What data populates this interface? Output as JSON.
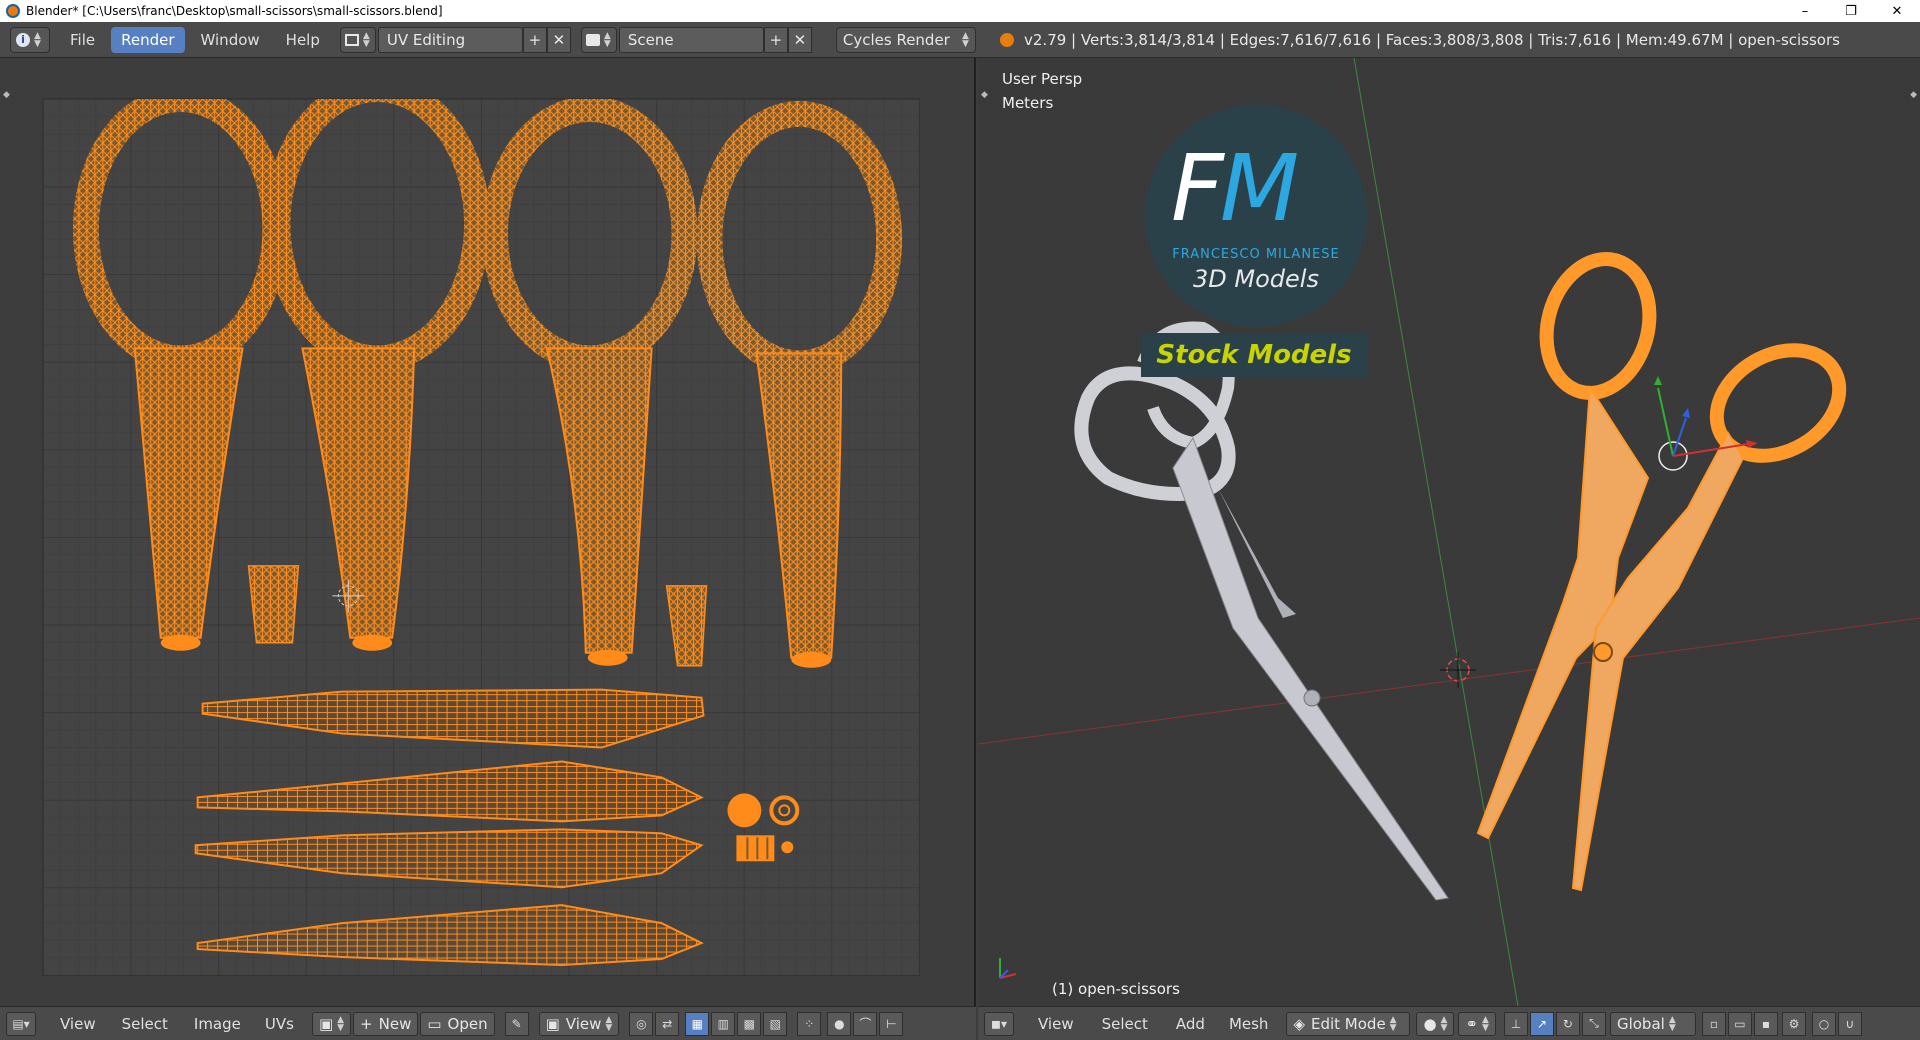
{
  "window": {
    "title": "Blender* [C:\\Users\\franc\\Desktop\\small-scissors\\small-scissors.blend]",
    "controls": [
      "–",
      "❐",
      "✕"
    ]
  },
  "topbar": {
    "menus": [
      "File",
      "Render",
      "Window",
      "Help"
    ],
    "active_menu": "Render",
    "screen_layout": "UV Editing",
    "scene": "Scene",
    "render_engine": "Cycles Render",
    "stats": "v2.79 | Verts:3,814/3,814 | Edges:7,616/7,616 | Faces:3,808/3,808 | Tris:7,616 | Mem:49.67M | open-scissors"
  },
  "viewport": {
    "view_name": "User Persp",
    "units": "Meters",
    "object_label": "(1) open-scissors"
  },
  "watermark": {
    "logo_letters": "FM",
    "author": "FRANCESCO MILANESE",
    "subtitle": "3D Models",
    "band_text": "Stock Models"
  },
  "uv_footer": {
    "menus": [
      "View",
      "Select",
      "Image",
      "UVs"
    ],
    "new_label": "New",
    "open_label": "Open",
    "view_label": "View"
  },
  "vp_footer": {
    "menus": [
      "View",
      "Select",
      "Add",
      "Mesh"
    ],
    "mode": "Edit Mode",
    "orientation": "Global"
  },
  "colors": {
    "uv_orange": "#ff8c1a",
    "selection_orange": "#ffa033",
    "accent_blue": "#5680c2",
    "axis_red": "#c03030",
    "axis_green": "#2fa02f",
    "watermark_blue": "#2da7e0",
    "watermark_yellow": "#c8d400"
  }
}
